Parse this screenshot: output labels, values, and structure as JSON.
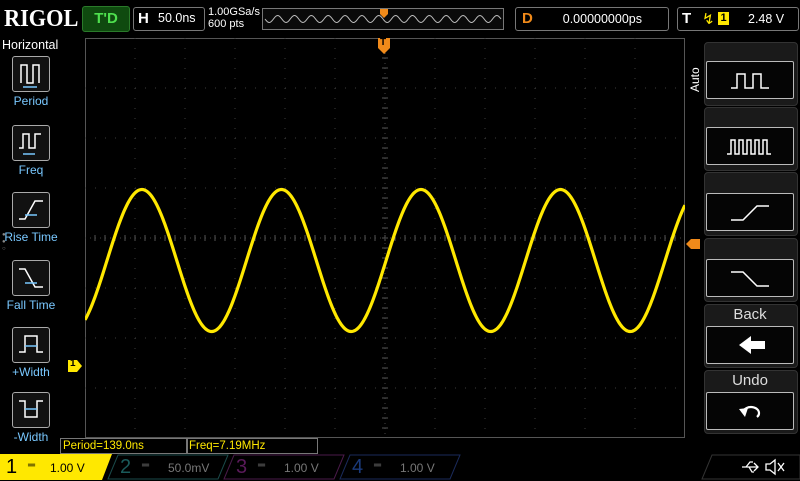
{
  "brand": "RIGOL",
  "status": "T'D",
  "horizontal": {
    "label": "H",
    "timebase": "50.0ns",
    "sample_rate": "1.00GSa/s",
    "memory_depth": "600 pts"
  },
  "delay": {
    "label": "D",
    "value": "0.00000000ps"
  },
  "trigger": {
    "label": "T",
    "edge": "rising-edge-icon",
    "source": "1",
    "level": "2.48 V"
  },
  "left_menu": {
    "title": "Horizontal",
    "items": [
      {
        "label": "Period",
        "icon": "period-icon"
      },
      {
        "label": "Freq",
        "icon": "frequency-icon"
      },
      {
        "label": "Rise Time",
        "icon": "rise-time-icon"
      },
      {
        "label": "Fall Time",
        "icon": "fall-time-icon"
      },
      {
        "label": "+Width",
        "icon": "positive-width-icon"
      },
      {
        "label": "-Width",
        "icon": "negative-width-icon"
      }
    ]
  },
  "right_menu": {
    "mode": "Auto",
    "back_label": "Back",
    "undo_label": "Undo"
  },
  "measurements": {
    "period": "Period=139.0ns",
    "freq": "Freq=7.19MHz"
  },
  "channels": [
    {
      "num": "1",
      "scale": "1.00 V",
      "color": "#ffe800",
      "active": true
    },
    {
      "num": "2",
      "scale": "50.0mV",
      "color": "#00c8c8",
      "active": false
    },
    {
      "num": "3",
      "scale": "1.00 V",
      "color": "#e000e0",
      "active": false
    },
    {
      "num": "4",
      "scale": "1.00 V",
      "color": "#1e7cff",
      "active": false
    }
  ],
  "trigger_marker": "T",
  "ch1_marker": "1",
  "colors": {
    "ch1": "#ffe800",
    "menu_label": "#79c8ff",
    "delay": "#f08a1a",
    "grid": "#3c3c3c"
  },
  "waveform": {
    "periods_on_screen": 4.3,
    "amplitude_div": 1.42,
    "offset_div": 0.45
  }
}
